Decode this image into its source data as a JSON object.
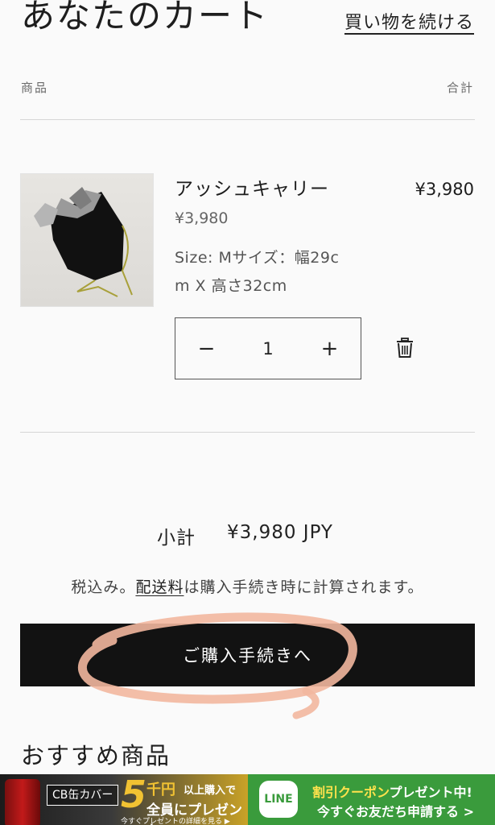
{
  "header": {
    "title": "あなたのカート",
    "continue_shopping": "買い物を続ける"
  },
  "table": {
    "col_product": "商品",
    "col_total": "合計"
  },
  "item": {
    "name": "アッシュキャリー",
    "price": "¥3,980",
    "line_total": "¥3,980",
    "size_line1": "Size: Mサイズ：幅29c",
    "size_line2": "m X 高さ32cm",
    "quantity": "1",
    "minus_glyph": "−",
    "plus_glyph": "+",
    "image_icon": "product-bag-icon"
  },
  "summary": {
    "subtotal_label": "小計",
    "subtotal_value": "¥3,980 JPY",
    "tax_prefix": "税込み。",
    "shipping_link": "配送料",
    "tax_suffix": "は購入手続き時に計算されます。",
    "checkout_label": "ご購入手続きへ"
  },
  "recommendations": {
    "title": "おすすめ商品"
  },
  "banner": {
    "left_cb": "CB缶カバー",
    "left_five": "5",
    "left_yen": "千円",
    "left_line1": "以上購入で",
    "left_line2": "全員にプレゼント",
    "left_foot": "今すぐプレゼントの詳細を見る ▶",
    "right_logo": "LINE",
    "right_line1_hl": "割引クーポン",
    "right_line1": "プレゼント中!",
    "right_line2": "今すぐお友だち申請する >"
  },
  "colors": {
    "checkout_bg": "#121212",
    "highlight_circle": "#f2b79f",
    "line_green": "#3a9b3c"
  }
}
